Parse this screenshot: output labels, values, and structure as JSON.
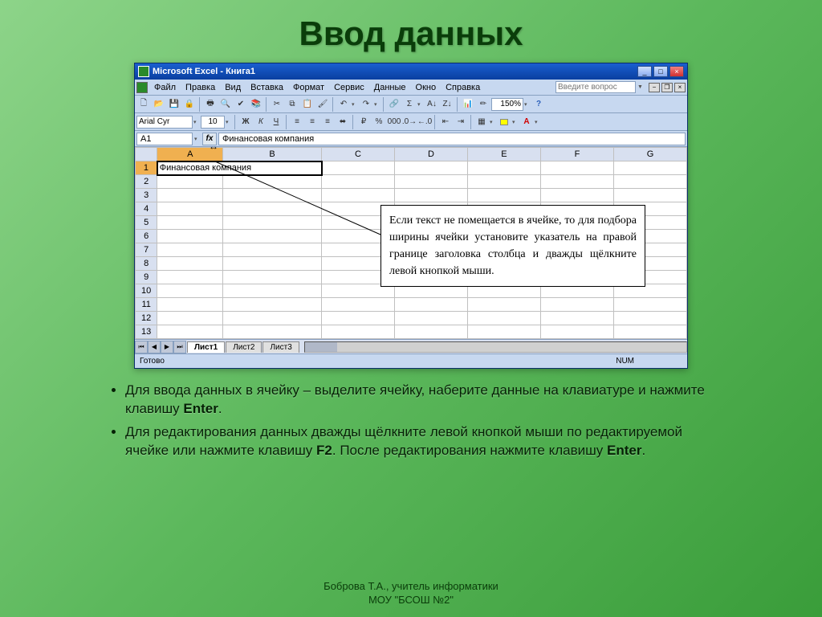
{
  "slide": {
    "title": "Ввод данных",
    "bullet1_pre": "Для ввода данных в ячейку – выделите ячейку, наберите данные на клавиатуре и нажмите клавишу ",
    "bullet1_key": "Enter",
    "bullet1_post": ".",
    "bullet2_pre": "Для редактирования данных дважды щёлкните левой кнопкой мыши по редактируемой ячейке или нажмите клавишу ",
    "bullet2_key1": "F2",
    "bullet2_mid": ". После редактирования нажмите клавишу ",
    "bullet2_key2": "Enter",
    "bullet2_post": "."
  },
  "footer": {
    "line1": "Боброва Т.А., учитель информатики",
    "line2": "МОУ \"БСОШ №2\""
  },
  "excel": {
    "title": "Microsoft Excel - Книга1",
    "help_placeholder": "Введите вопрос",
    "menus": [
      "Файл",
      "Правка",
      "Вид",
      "Вставка",
      "Формат",
      "Сервис",
      "Данные",
      "Окно",
      "Справка"
    ],
    "font_name": "Arial Cyr",
    "font_size": "10",
    "zoom": "150%",
    "namebox": "A1",
    "formula": "Финансовая компания",
    "columns": [
      "A",
      "B",
      "C",
      "D",
      "E",
      "F",
      "G"
    ],
    "rows": [
      "1",
      "2",
      "3",
      "4",
      "5",
      "6",
      "7",
      "8",
      "9",
      "10",
      "11",
      "12",
      "13"
    ],
    "cell_A1": "Финансовая компания",
    "tip": "Если текст не помещается в ячейке, то для подбора ширины ячейки установите указатель на правой границе заголовка столбца и дважды щёлкните левой кнопкой мыши.",
    "sheets": [
      "Лист1",
      "Лист2",
      "Лист3"
    ],
    "status": "Готово",
    "num": "NUM"
  },
  "winbtns": {
    "min": "_",
    "max": "□",
    "close": "×"
  },
  "docbtns": {
    "min": "−",
    "restore": "❐",
    "close": "×"
  }
}
